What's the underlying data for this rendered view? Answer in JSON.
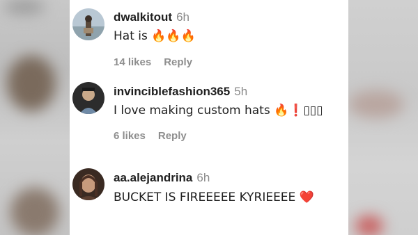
{
  "comments": [
    {
      "username": "dwalkitout",
      "time": "6h",
      "text": "Hat is 🔥🔥🔥",
      "likes": "14 likes",
      "reply": "Reply"
    },
    {
      "username": "invinciblefashion365",
      "time": "5h",
      "text": "I love making custom hats 🔥❗▯▯▯",
      "likes": "6 likes",
      "reply": "Reply"
    },
    {
      "username": "aa.alejandrina",
      "time": "6h",
      "text": "BUCKET IS FIREEEEE KYRIEEEE ❤️",
      "likes": "",
      "reply": ""
    }
  ]
}
